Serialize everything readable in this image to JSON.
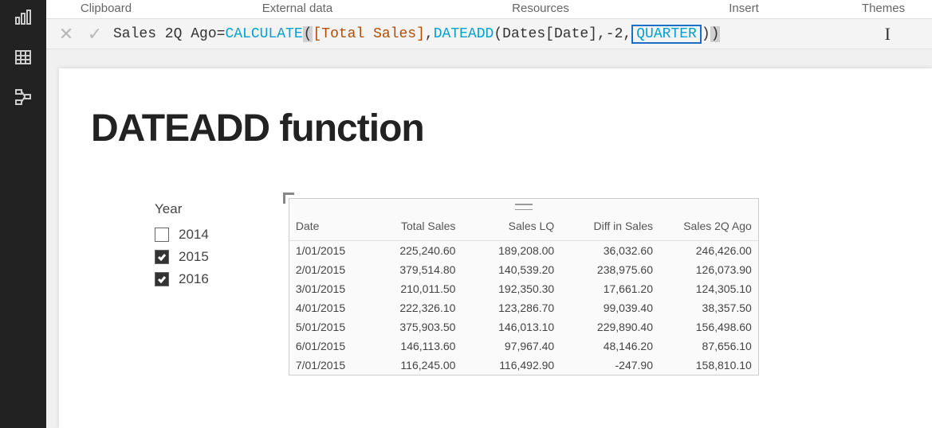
{
  "ribbon": {
    "tabs": [
      "Clipboard",
      "External data",
      "Resources",
      "Insert",
      "Themes"
    ]
  },
  "formula": {
    "lhs": "Sales 2Q Ago",
    "eq": " = ",
    "fn1": "CALCULATE",
    "arg1": " [Total Sales]",
    "fn2": "DATEADD",
    "arg2a": " Dates[Date]",
    "arg2b": "-2",
    "quarter": "QUARTER",
    "close1": ")",
    "close2": ")"
  },
  "page": {
    "title": "DATEADD function"
  },
  "slicer": {
    "title": "Year",
    "items": [
      {
        "label": "2014",
        "checked": false
      },
      {
        "label": "2015",
        "checked": true
      },
      {
        "label": "2016",
        "checked": true
      }
    ]
  },
  "table": {
    "headers": [
      "Date",
      "Total Sales",
      "Sales LQ",
      "Diff in Sales",
      "Sales 2Q Ago"
    ],
    "rows": [
      {
        "date": "1/01/2015",
        "v1": "225,240.60",
        "v2": "189,208.00",
        "v3": "36,032.60",
        "v4": "246,426.00"
      },
      {
        "date": "2/01/2015",
        "v1": "379,514.80",
        "v2": "140,539.20",
        "v3": "238,975.60",
        "v4": "126,073.90"
      },
      {
        "date": "3/01/2015",
        "v1": "210,011.50",
        "v2": "192,350.30",
        "v3": "17,661.20",
        "v4": "124,305.10"
      },
      {
        "date": "4/01/2015",
        "v1": "222,326.10",
        "v2": "123,286.70",
        "v3": "99,039.40",
        "v4": "38,357.50"
      },
      {
        "date": "5/01/2015",
        "v1": "375,903.50",
        "v2": "146,013.10",
        "v3": "229,890.40",
        "v4": "156,498.60"
      },
      {
        "date": "6/01/2015",
        "v1": "146,113.60",
        "v2": "97,967.40",
        "v3": "48,146.20",
        "v4": "87,656.10"
      },
      {
        "date": "7/01/2015",
        "v1": "116,245.00",
        "v2": "116,492.90",
        "v3": "-247.90",
        "v4": "158,810.10"
      }
    ]
  }
}
